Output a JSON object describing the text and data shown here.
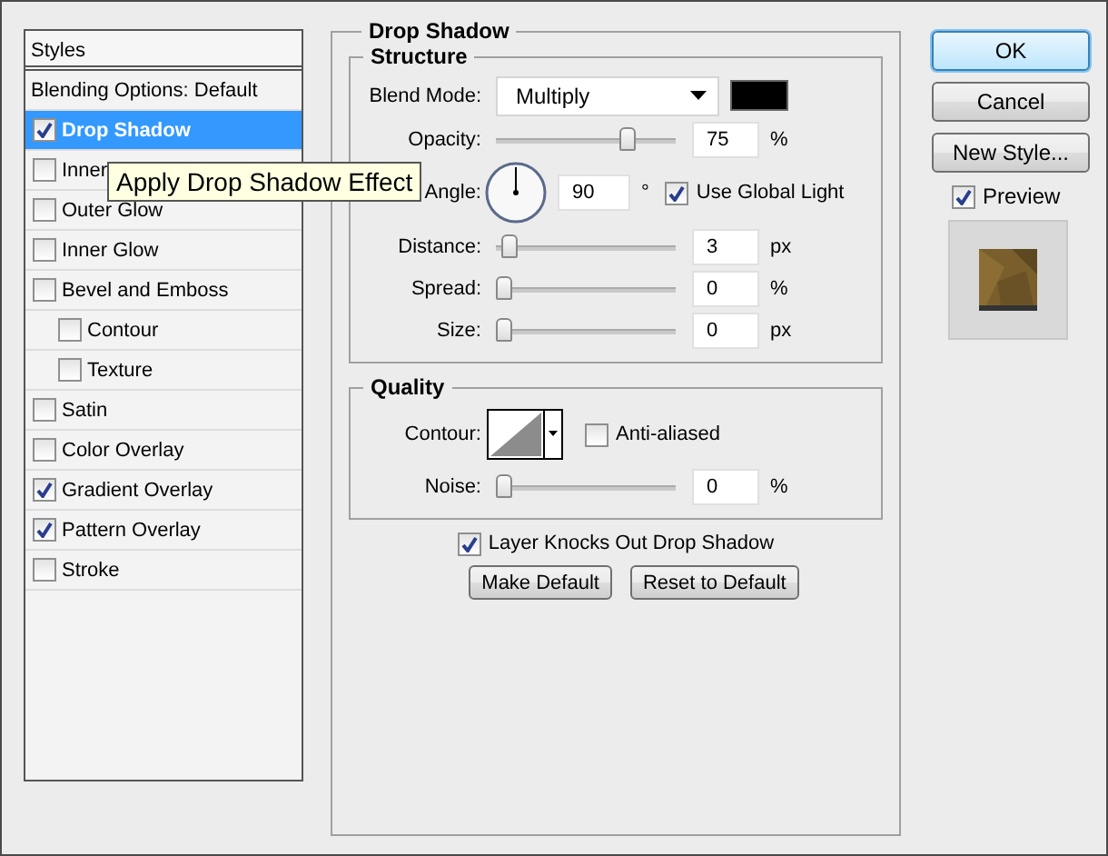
{
  "styles_panel": {
    "title": "Styles",
    "items": [
      {
        "label": "Blending Options: Default",
        "kind": "header",
        "selected": false
      },
      {
        "label": "Drop Shadow",
        "kind": "effect",
        "checked": true,
        "selected": true
      },
      {
        "label": "Inner",
        "kind": "effect",
        "checked": false,
        "selected": false
      },
      {
        "label": "Outer Glow",
        "kind": "effect",
        "checked": false,
        "selected": false
      },
      {
        "label": "Inner Glow",
        "kind": "effect",
        "checked": false,
        "selected": false
      },
      {
        "label": "Bevel and Emboss",
        "kind": "effect",
        "checked": false,
        "selected": false,
        "children": [
          {
            "label": "Contour",
            "kind": "effect",
            "checked": false,
            "selected": false
          },
          {
            "label": "Texture",
            "kind": "effect",
            "checked": false,
            "selected": false
          }
        ]
      },
      {
        "label": "Satin",
        "kind": "effect",
        "checked": false,
        "selected": false
      },
      {
        "label": "Color Overlay",
        "kind": "effect",
        "checked": false,
        "selected": false
      },
      {
        "label": "Gradient Overlay",
        "kind": "effect",
        "checked": true,
        "selected": false
      },
      {
        "label": "Pattern Overlay",
        "kind": "effect",
        "checked": true,
        "selected": false
      },
      {
        "label": "Stroke",
        "kind": "effect",
        "checked": false,
        "selected": false
      }
    ]
  },
  "tooltip": {
    "text": "Apply Drop Shadow Effect"
  },
  "drop_shadow": {
    "title": "Drop Shadow",
    "structure": {
      "title": "Structure",
      "blend_mode": {
        "label": "Blend Mode:",
        "value": "Multiply",
        "color": "#000000"
      },
      "opacity": {
        "label": "Opacity:",
        "level": 0.75,
        "value": "75",
        "unit": "%"
      },
      "angle": {
        "label": "Angle:",
        "value": "90",
        "unit": "°",
        "global_light": {
          "label": "Use Global Light",
          "checked": true
        }
      },
      "distance": {
        "label": "Distance:",
        "level": 0.03,
        "value": "3",
        "unit": "px"
      },
      "spread": {
        "label": "Spread:",
        "level": 0,
        "value": "0",
        "unit": "%"
      },
      "size": {
        "label": "Size:",
        "level": 0,
        "value": "0",
        "unit": "px"
      }
    },
    "quality": {
      "title": "Quality",
      "contour": {
        "label": "Contour:",
        "anti_aliased": {
          "label": "Anti-aliased",
          "checked": false
        }
      },
      "noise": {
        "label": "Noise:",
        "level": 0,
        "value": "0",
        "unit": "%"
      }
    },
    "knockout": {
      "label": "Layer Knocks Out Drop Shadow",
      "checked": true
    },
    "buttons": [
      "Make Default",
      "Reset to Default"
    ]
  },
  "actions": [
    {
      "label": "OK",
      "default": true
    },
    {
      "label": "Cancel",
      "default": false
    },
    {
      "label": "New Style...",
      "default": false
    }
  ],
  "preview": {
    "label": "Preview",
    "checked": true
  }
}
